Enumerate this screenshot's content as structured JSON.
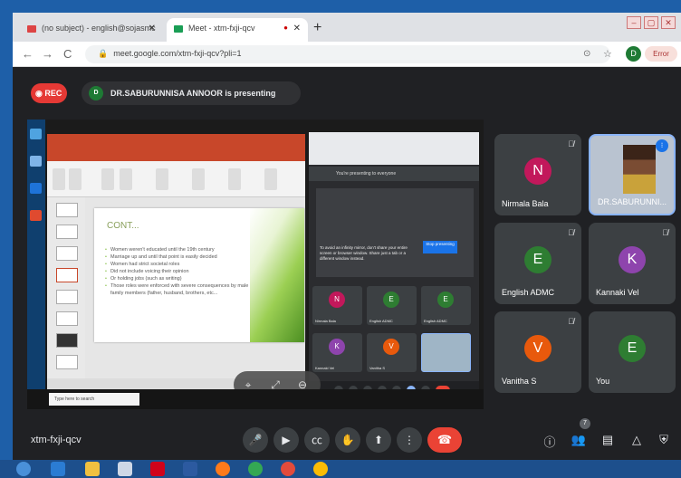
{
  "browser": {
    "tabs": [
      {
        "label": "(no subject) - english@sojasmc",
        "active": false
      },
      {
        "label": "Meet - xtm-fxji-qcv",
        "active": true
      }
    ],
    "new_tab": "+",
    "url": "meet.google.com/xtm-fxji-qcv?pli=1",
    "profile_initial": "D",
    "error_label": "Error"
  },
  "meet": {
    "rec_label": "REC",
    "presenter_initial": "D",
    "presenting_text": "DR.SABURUNNISA ANNOOR is presenting",
    "meeting_code": "xtm-fxji-qcv",
    "participant_count": "7",
    "colors": {
      "rec": "#e53935",
      "end_call": "#ea4335",
      "tile_bg": "#3c4043"
    }
  },
  "slide": {
    "title": "CONT...",
    "bullets": [
      "Women weren't educated until the 19th century",
      "Marriage up and until that point is easily decided",
      "Women had strict societal roles",
      "Did not include voicing their opinion",
      "Or holding jobs (such as writing)",
      "Those roles were enforced with severe consequences by male family members (father, husband, brothers, etc..."
    ]
  },
  "inner_meet": {
    "presenting_text": "You're presenting to everyone",
    "stop_label": "Stop presenting",
    "note": "To avoid an infinity mirror, don't share your entire screen or browser window. Share just a tab or a different window instead.",
    "tiles": [
      {
        "initial": "N",
        "name": "Nirmala Bala",
        "color": "#c2185b"
      },
      {
        "initial": "E",
        "name": "English ADMC",
        "color": "#2e7d32"
      },
      {
        "initial": "E",
        "name": "English ADMC",
        "color": "#2e7d32"
      },
      {
        "initial": "K",
        "name": "Kannaki Vel",
        "color": "#8e44ad"
      },
      {
        "initial": "V",
        "name": "Vanitha S",
        "color": "#e8590c"
      }
    ],
    "taskbar_search": "Type here to search"
  },
  "participants": [
    {
      "initial": "N",
      "name": "Nirmala Bala",
      "color": "#c2185b"
    },
    {
      "initial": "",
      "name": "DR.SABURUNNI...",
      "color": ""
    },
    {
      "initial": "E",
      "name": "English ADMC",
      "color": "#2e7d32"
    },
    {
      "initial": "K",
      "name": "Kannaki Vel",
      "color": "#8e44ad"
    },
    {
      "initial": "V",
      "name": "Vanitha S",
      "color": "#e8590c"
    },
    {
      "initial": "E",
      "name": "You",
      "color": "#2e7d32"
    }
  ]
}
